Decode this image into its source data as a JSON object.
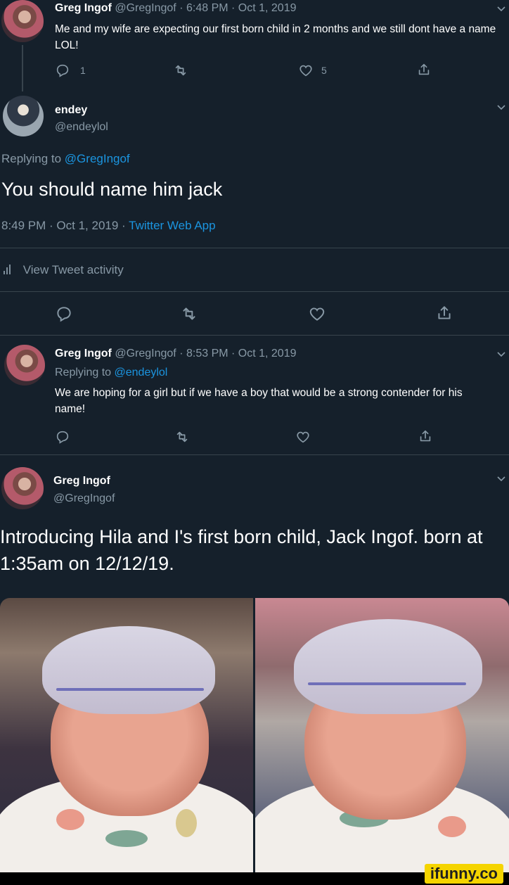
{
  "tweet1": {
    "name": "Greg Ingof",
    "handle": "@GregIngof",
    "meta": "· 6:48 PM · Oct 1, 2019",
    "text": "Me and my wife are expecting our first born child in 2 months and we still dont have a name LOL!",
    "reply_count": "1",
    "like_count": "5"
  },
  "main_tweet": {
    "name": "endey",
    "handle": "@endeylol",
    "replying_prefix": "Replying to",
    "replying_handle": "@GregIngof",
    "text": "You should name him jack",
    "timestamp": "8:49 PM · Oct 1, 2019 ·",
    "source": "Twitter Web App",
    "activity_label": "View Tweet activity"
  },
  "reply_tweet": {
    "name": "Greg Ingof",
    "handle": "@GregIngof",
    "meta": "· 8:53 PM · Oct 1, 2019",
    "replying_prefix": "Replying to",
    "replying_handle": "@endeylol",
    "text": "We are hoping for a girl but if we have a boy that would be a strong contender for his name!"
  },
  "final_tweet": {
    "name": "Greg Ingof",
    "handle": "@GregIngof",
    "text": "Introducing Hila and I's first born child, Jack Ingof. born at 1:35am on 12/12/19."
  },
  "watermark": "ifunny.co",
  "icons": [
    "reply-icon",
    "retweet-icon",
    "like-icon",
    "share-icon",
    "chevron-down-icon",
    "bar-chart-icon"
  ],
  "colors": {
    "background": "#15202b",
    "text": "#ffffff",
    "muted": "#8899a6",
    "link": "#1b95e0",
    "divider": "#38444d"
  }
}
